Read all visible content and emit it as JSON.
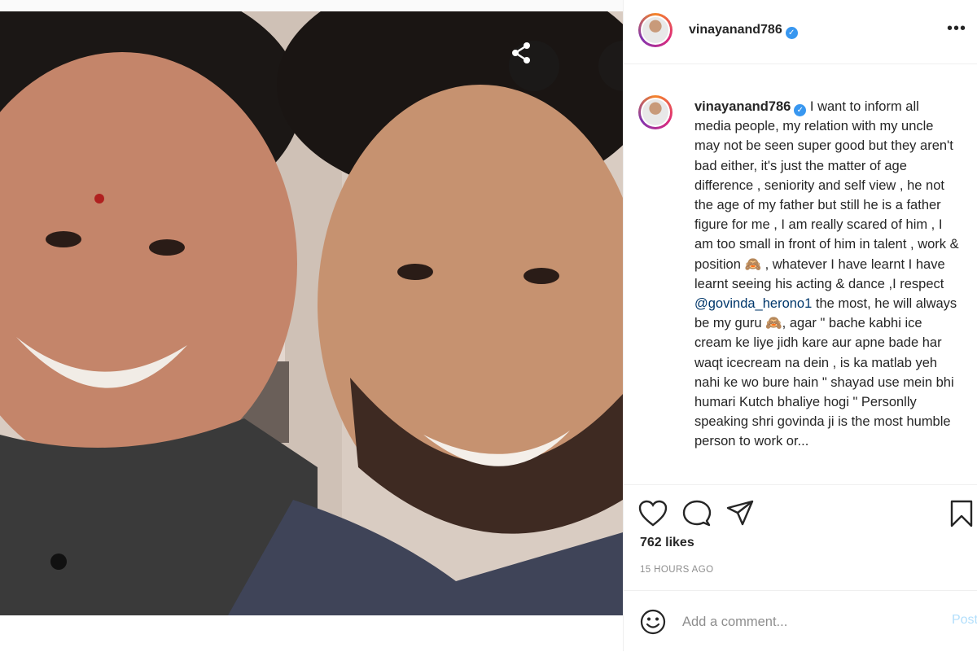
{
  "post": {
    "username": "vinayanand786",
    "verified_mark": "✓",
    "more_label": "•••",
    "caption_before_mention": "I want to inform all media people, my relation with my uncle may not be seen super good but they aren't bad either, it's just the matter of age difference , seniority and self view , he not the age of my father but still he is a father figure for me , I am really scared of him , I am too small in front of him in talent , work & position 🙈 , whatever I have learnt I have learnt seeing his acting & dance ,I respect ",
    "mention": "@govinda_herono1",
    "caption_after_mention": " the most, he will always be my guru 🙈, agar \" bache kabhi ice cream ke liye jidh kare aur apne bade har waqt icecream na dein , is ka matlab yeh nahi ke wo bure hain \" shayad use mein bhi humari Kutch bhaliye hogi \" Personlly speaking shri govinda ji is the most humble person to work or... ",
    "likes": "762 likes",
    "timestamp": "15 HOURS AGO"
  },
  "comment": {
    "placeholder": "Add a comment...",
    "post_label": "Post"
  },
  "icons": {
    "share": "share-icon",
    "like": "heart-icon",
    "comment": "comment-icon",
    "send": "send-icon",
    "save": "bookmark-icon",
    "emoji": "emoji-icon"
  },
  "colors": {
    "verified": "#3897f0",
    "mention": "#00376b",
    "post_button_disabled": "#b2dffc",
    "muted_text": "#8e8e8e"
  }
}
